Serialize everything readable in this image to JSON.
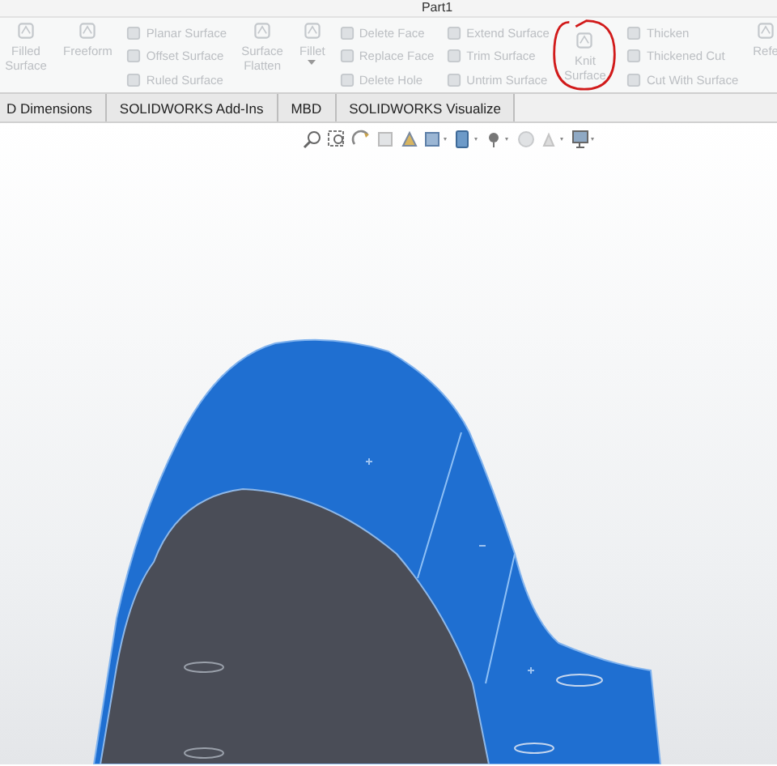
{
  "window": {
    "title": "Part1"
  },
  "toolbar": {
    "groups": [
      {
        "kind": "large",
        "items": [
          {
            "label": "Filled Surface",
            "disabled": true,
            "dropdown": false
          },
          {
            "label": "Freeform",
            "disabled": true,
            "dropdown": false
          }
        ]
      },
      {
        "kind": "list",
        "items": [
          {
            "label": "Planar Surface",
            "disabled": true
          },
          {
            "label": "Offset Surface",
            "disabled": true
          },
          {
            "label": "Ruled Surface",
            "disabled": true
          }
        ]
      },
      {
        "kind": "large",
        "items": [
          {
            "label": "Surface Flatten",
            "disabled": true,
            "dropdown": false
          },
          {
            "label": "Fillet",
            "disabled": true,
            "dropdown": true
          }
        ]
      },
      {
        "kind": "list",
        "items": [
          {
            "label": "Delete Face",
            "disabled": true
          },
          {
            "label": "Replace Face",
            "disabled": true
          },
          {
            "label": "Delete Hole",
            "disabled": true
          }
        ]
      },
      {
        "kind": "list",
        "items": [
          {
            "label": "Extend Surface",
            "disabled": true
          },
          {
            "label": "Trim Surface",
            "disabled": true
          },
          {
            "label": "Untrim Surface",
            "disabled": true
          }
        ]
      },
      {
        "kind": "large",
        "items": [
          {
            "label": "Knit Surface",
            "disabled": true,
            "dropdown": false
          }
        ]
      },
      {
        "kind": "list",
        "items": [
          {
            "label": "Thicken",
            "disabled": true
          },
          {
            "label": "Thickened Cut",
            "disabled": true
          },
          {
            "label": "Cut With Surface",
            "disabled": true
          }
        ]
      },
      {
        "kind": "large",
        "items": [
          {
            "label": "Refe",
            "disabled": true,
            "dropdown": false
          }
        ]
      }
    ]
  },
  "tabs": [
    {
      "label": "D Dimensions",
      "selected": false
    },
    {
      "label": "SOLIDWORKS Add-Ins",
      "selected": false
    },
    {
      "label": "MBD",
      "selected": false
    },
    {
      "label": "SOLIDWORKS Visualize",
      "selected": false
    }
  ]
}
